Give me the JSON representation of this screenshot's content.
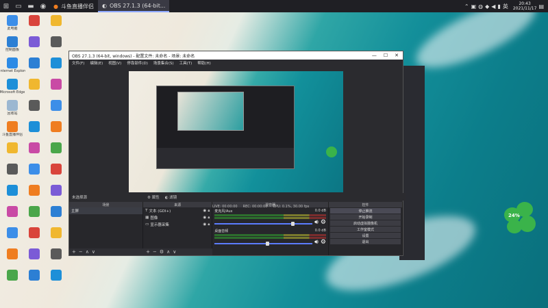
{
  "taskbar": {
    "tasks": [
      {
        "label": "斗鱼直播伴侣",
        "icon": "douyu-icon",
        "active": false
      },
      {
        "label": "OBS 27.1.3 (64-bit...",
        "icon": "obs-icon",
        "active": true
      }
    ],
    "clock_time": "20:43",
    "clock_date": "2021/11/17"
  },
  "obs": {
    "title": "OBS 27.1.3 (64-bit, windows) - 配置文件: 未命名 - 场景: 未命名",
    "menu": [
      "文件(F)",
      "编辑(E)",
      "视图(V)",
      "停靠部件(D)",
      "场景集合(S)",
      "工具(T)",
      "帮助(H)"
    ],
    "no_source_label": "未选择源",
    "properties_label": "属性",
    "filters_label": "滤镜",
    "docks": {
      "scenes_header": "场景",
      "sources_header": "来源",
      "mixer_header": "混音器",
      "controls_header": "控件"
    },
    "scenes": [
      "主屏"
    ],
    "sources": [
      {
        "label": "文本 (GDI+)",
        "icon": "text-icon"
      },
      {
        "label": "图像",
        "icon": "image-icon"
      },
      {
        "label": "显示器采集",
        "icon": "monitor-icon"
      }
    ],
    "mixer": [
      {
        "name": "麦克风/Aux",
        "db": "0.0 dB",
        "level": 0.78
      },
      {
        "name": "桌面音频",
        "db": "0.0 dB",
        "level": 0.52
      }
    ],
    "controls": [
      "停止推流",
      "开始录制",
      "启动虚拟摄像机",
      "工作室模式",
      "设置",
      "退出"
    ],
    "status": {
      "live_label": "LIVE:",
      "live_time": "00:00:00",
      "rec_label": "REC:",
      "rec_time": "00:00:00",
      "cpu": "CPU: 0.1%, 30.00 fps"
    }
  },
  "desktop": {
    "icons": [
      {
        "label": "此电脑",
        "color": "#3c8ee8"
      },
      {
        "label": "控制面板",
        "color": "#2c7fd4"
      },
      {
        "label": "Internet Explorer",
        "color": "#2d8be5"
      },
      {
        "label": "Microsoft Edge",
        "color": "#1d8fd8"
      },
      {
        "label": "回收站",
        "color": "#9bb7d1"
      },
      {
        "label": "斗鱼直播伴侣",
        "color": "#ef7d20"
      }
    ],
    "clover_badge": "24%"
  }
}
